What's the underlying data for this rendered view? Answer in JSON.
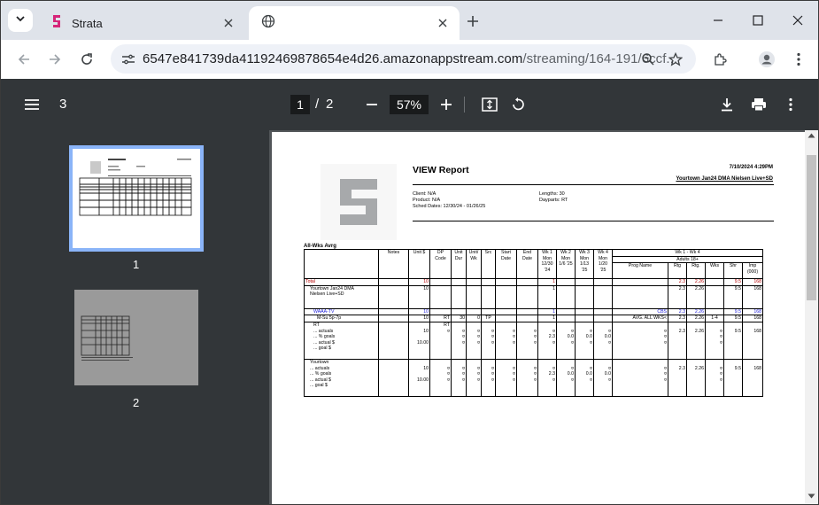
{
  "browser": {
    "tabs": [
      {
        "title": "Strata",
        "active": false
      },
      {
        "title": "",
        "active": true
      }
    ],
    "url_host": "6547e841739da41192469878654e4d26.amazonappstream.com",
    "url_rest": "/streaming/164-191/6ccf..."
  },
  "viewer": {
    "doc_title": "3",
    "current_page": "1",
    "page_sep": "/",
    "total_pages": "2",
    "zoom": "57%"
  },
  "thumbnails": [
    {
      "label": "1",
      "selected": true
    },
    {
      "label": "2",
      "selected": false
    }
  ],
  "report": {
    "title": "VIEW Report",
    "date": "7/10/2024 4:29PM",
    "dma": "Yourtown Jan24 DMA Nielsen Live+SD",
    "client": "Client: N/A",
    "product": "Product: N/A",
    "sched_dates": "Sched Dates: 12/30/24 - 01/26/25",
    "lengths": "Lengths: 30",
    "dayparts": "Dayparts: RT",
    "section": "All-Wks Avrg",
    "headers": {
      "notes": "Notes",
      "unit_cost": "Unit $",
      "dp": "DP",
      "code": "Code",
      "unit": "Unit",
      "dur": "Dur",
      "unit2": "Unit/",
      "wk": "Wk",
      "src": "Src",
      "start": "Start",
      "date": "Date",
      "end": "End",
      "date2": "Date",
      "wk1": [
        "Wk 1",
        "Mon",
        "12/30",
        "'24"
      ],
      "wk2": [
        "Wk 2",
        "Mon",
        "1/6 '25"
      ],
      "wk3": [
        "Wk 3",
        "Mon",
        "1/13",
        "'25"
      ],
      "wk4": [
        "Wk 4",
        "Mon",
        "1/20",
        "'25"
      ],
      "range": "Wk 1 - Wk 4",
      "demo": "Adults 18+",
      "prog_name": "Prog Name",
      "rtg": "Rtg",
      "rtg2": "Rtg.",
      "wks": "Wks",
      "shr": "Shr",
      "imp": "Imp",
      "imp_unit": "(000)"
    },
    "rows": {
      "total": {
        "label": "Total",
        "unit_cost": "10",
        "wk1": "1",
        "rtg": "2.3",
        "rtg2": "2.26",
        "shr": "9.5",
        "imp": "168"
      },
      "market": {
        "label1": "Yourtown Jan24 DMA",
        "label2": "Nielsen Live+SD",
        "unit_cost": "10",
        "wk1": "1",
        "rtg": "2.3",
        "rtg2": "2.26",
        "shr": "9.5",
        "imp": "168"
      },
      "station": {
        "label": "WAAA-TV",
        "unit_cost": "10",
        "wk1": "1",
        "prog": "CBS",
        "rtg": "2.3",
        "rtg2": "2.26",
        "shr": "9.5",
        "imp": "168"
      },
      "line": {
        "label": "M-Su 5p-7p",
        "unit_cost": "10",
        "dp": "RT",
        "dur": "30",
        "uw": "0",
        "src": "TP",
        "wk1": "1",
        "prog": "AVG. ALL WKS<",
        "rtg": "2.3",
        "rtg2": "2.26",
        "wks": "1-4",
        "shr": "9.5",
        "imp": "168"
      },
      "rt": {
        "label": "RT",
        "sub": [
          "... actuals",
          "... % goals",
          "... actual $",
          "... goal $"
        ],
        "unit_cost": "10",
        "dp": "RT",
        "goal": "10.00",
        "wk1": "2.3",
        "wk2": "0.0",
        "wk3": "0.0",
        "wk4": "0.0",
        "rtg": "2.3",
        "rtg2": "2.26",
        "shr": "9.5",
        "imp": "168",
        "mark": "¤"
      },
      "yourtown": {
        "label": "Yourtown",
        "sub": [
          "... actuals",
          "... % goals",
          "... actual $",
          "... goal $"
        ],
        "unit_cost": "10",
        "goal": "10.00",
        "wk1": "2.3",
        "wk2": "0.0",
        "wk3": "0.0",
        "wk4": "0.0",
        "rtg": "2.3",
        "rtg2": "2.26",
        "shr": "9.5",
        "imp": "168",
        "mark": "¤"
      }
    }
  }
}
